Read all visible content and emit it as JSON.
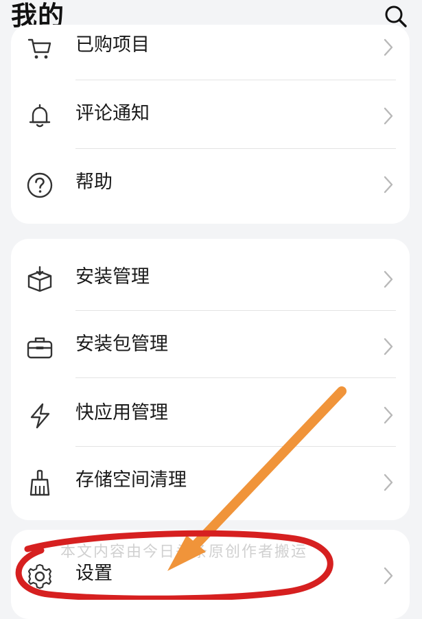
{
  "header": {
    "title": "我的",
    "search_icon": "search-icon"
  },
  "group1": {
    "items": [
      {
        "label": "已购项目",
        "icon": "cart-icon"
      },
      {
        "label": "评论通知",
        "icon": "bell-icon"
      },
      {
        "label": "帮助",
        "icon": "help-icon"
      }
    ]
  },
  "group2": {
    "items": [
      {
        "label": "安装管理",
        "icon": "package-box-icon"
      },
      {
        "label": "安装包管理",
        "icon": "briefcase-icon"
      },
      {
        "label": "快应用管理",
        "icon": "lightning-icon"
      },
      {
        "label": "存储空间清理",
        "icon": "broom-icon"
      }
    ]
  },
  "group3": {
    "items": [
      {
        "label": "设置",
        "icon": "gear-icon"
      }
    ]
  },
  "overlay": {
    "watermark": "本文内容由今日头条原创作者搬运",
    "annotation_color": "#f0943a",
    "circle_color": "#d62020"
  }
}
